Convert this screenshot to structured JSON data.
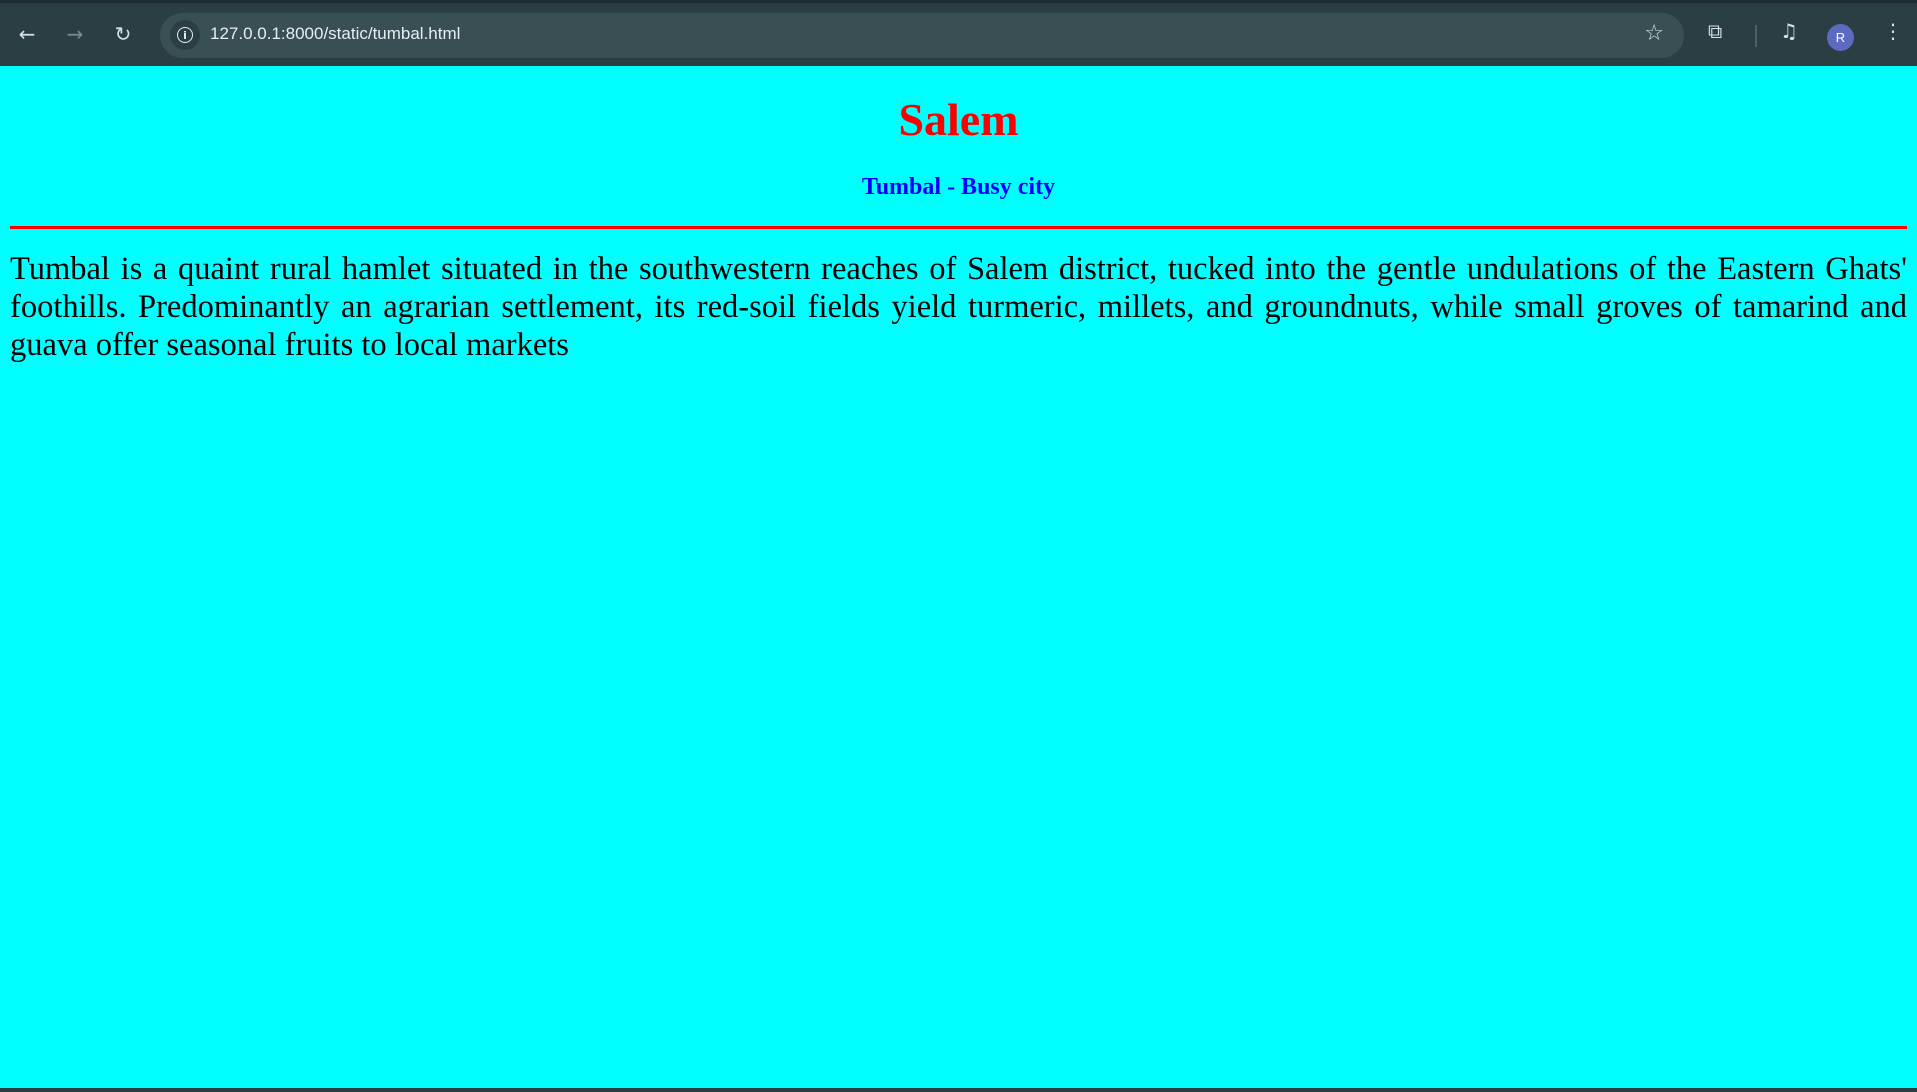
{
  "browser": {
    "url": "127.0.0.1:8000/static/tumbal.html",
    "profile_initial": "R",
    "accent": "#5c6bc0",
    "icons": [
      "back-icon",
      "forward-icon",
      "reload-icon",
      "site-info-icon",
      "bookmark-star-icon",
      "extensions-icon",
      "media-queue-icon",
      "menu-kebab-icon"
    ]
  },
  "page": {
    "background": "#00ffff",
    "title": "Salem",
    "title_color": "#ff0000",
    "subtitle": "Tumbal - Busy city",
    "subtitle_color": "#0000ff",
    "rule_color": "#ff0000",
    "paragraph": "Tumbal is a quaint rural hamlet situated in the southwestern reaches of Salem district, tucked into the gentle undulations of the Eastern Ghats' foothills. Predominantly an agrarian settlement, its red-soil fields yield turmeric, millets, and groundnuts, while small groves of tamarind and guava offer seasonal fruits to local markets"
  }
}
